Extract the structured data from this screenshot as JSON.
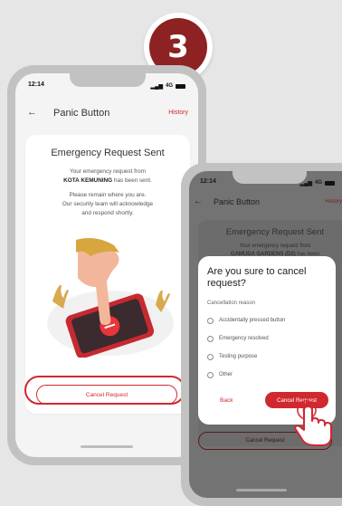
{
  "step_number": "3",
  "status_bar": {
    "time": "12:14",
    "network": "4G"
  },
  "screen1": {
    "title": "Panic Button",
    "history_label": "History",
    "card_title": "Emergency Request Sent",
    "msg_line1": "Your emergency request from",
    "msg_location": "KOTA KEMUNING",
    "msg_line2_suffix": "has been sent.",
    "info_line1": "Please remain where you are.",
    "info_line2": "Our security team will acknowledge",
    "info_line3": "and respond shortly.",
    "cancel_button": "Cancel Request"
  },
  "screen2": {
    "title": "Panic Button",
    "history_label": "History",
    "bg_card_title": "Emergency Request Sent",
    "bg_msg_line1": "Your emergency request from",
    "bg_msg_location": "GAMUDA GARDENS (D2)",
    "bg_msg_suffix": "has been",
    "bg_cancel_button": "Cancel Request",
    "modal": {
      "title": "Are you sure to cancel request?",
      "subtitle": "Cancellation reason",
      "options": [
        "Accidentally pressed button",
        "Emergency resolved",
        "Testing purpose",
        "Other"
      ],
      "back_label": "Back",
      "confirm_label": "Cancel Request"
    }
  },
  "colors": {
    "accent": "#d0282e",
    "badge": "#8e2121"
  }
}
